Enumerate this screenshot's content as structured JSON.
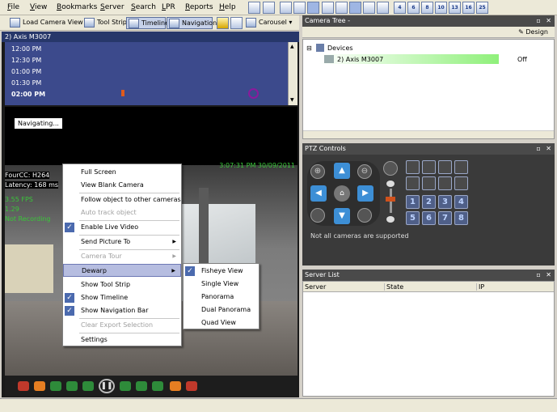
{
  "menu": [
    "File",
    "View",
    "Bookmarks",
    "Server",
    "Search",
    "LPR",
    "Reports",
    "Help"
  ],
  "layout_buttons": [
    "4",
    "6",
    "8",
    "10",
    "13",
    "16",
    "25"
  ],
  "toolbar": {
    "load_camera_view": "Load Camera View",
    "tool_strip": "Tool Strip",
    "timeline": "Timeline",
    "navigation": "Navigation",
    "carousel": "Carousel"
  },
  "camera": {
    "title": "2) Axis M3007",
    "navigating": "Navigating...",
    "timestamp": "3:07:31 PM 30/09/2011",
    "fourcc": "FourCC: H264",
    "latency": "Latency:  168 ms",
    "fps": "3.55 FPS",
    "line2": "1.29",
    "recording": "Not Recording",
    "timeline_times": [
      "12:00 PM",
      "12:30 PM",
      "01:00 PM",
      "01:30 PM",
      "02:00 PM"
    ]
  },
  "context_menu": {
    "items": [
      {
        "label": "Full Screen",
        "checked": false,
        "disabled": false,
        "submenu": false
      },
      {
        "label": "View Blank Camera",
        "checked": false,
        "disabled": false,
        "submenu": false
      },
      {
        "label": "Follow object to other cameras",
        "checked": false,
        "disabled": false,
        "submenu": false
      },
      {
        "label": "Auto track object",
        "checked": false,
        "disabled": true,
        "submenu": false
      },
      {
        "label": "Enable Live Video",
        "checked": true,
        "disabled": false,
        "submenu": false
      },
      {
        "label": "Send Picture To",
        "checked": false,
        "disabled": false,
        "submenu": true
      },
      {
        "label": "Camera Tour",
        "checked": false,
        "disabled": true,
        "submenu": true
      },
      {
        "label": "Dewarp",
        "checked": false,
        "disabled": false,
        "submenu": true,
        "highlighted": true
      },
      {
        "label": "Show Tool Strip",
        "checked": false,
        "disabled": false,
        "submenu": false
      },
      {
        "label": "Show Timeline",
        "checked": true,
        "disabled": false,
        "submenu": false
      },
      {
        "label": "Show Navigation Bar",
        "checked": true,
        "disabled": false,
        "submenu": false
      },
      {
        "label": "Clear Export Selection",
        "checked": false,
        "disabled": true,
        "submenu": false
      },
      {
        "label": "Settings",
        "checked": false,
        "disabled": false,
        "submenu": false
      }
    ]
  },
  "dewarp_menu": {
    "items": [
      {
        "label": "Fisheye View",
        "checked": true
      },
      {
        "label": "Single View",
        "checked": false
      },
      {
        "label": "Panorama",
        "checked": false
      },
      {
        "label": "Dual Panorama",
        "checked": false
      },
      {
        "label": "Quad View",
        "checked": false
      }
    ]
  },
  "camera_tree": {
    "title": "Camera Tree -",
    "design_label": "Design",
    "root": "Devices",
    "camera": "2) Axis M3007",
    "status": "Off"
  },
  "ptz": {
    "title": "PTZ Controls",
    "note": "Not all cameras are supported",
    "presets": [
      "1",
      "2",
      "3",
      "4",
      "5",
      "6",
      "7",
      "8"
    ]
  },
  "server_list": {
    "title": "Server List",
    "columns": [
      "Server",
      "State",
      "IP"
    ]
  },
  "colors": {
    "accent": "#27376a",
    "timeline_bg": "#3c4a8c",
    "overlay_green": "#39c639",
    "status_green": "#8ff07a"
  }
}
